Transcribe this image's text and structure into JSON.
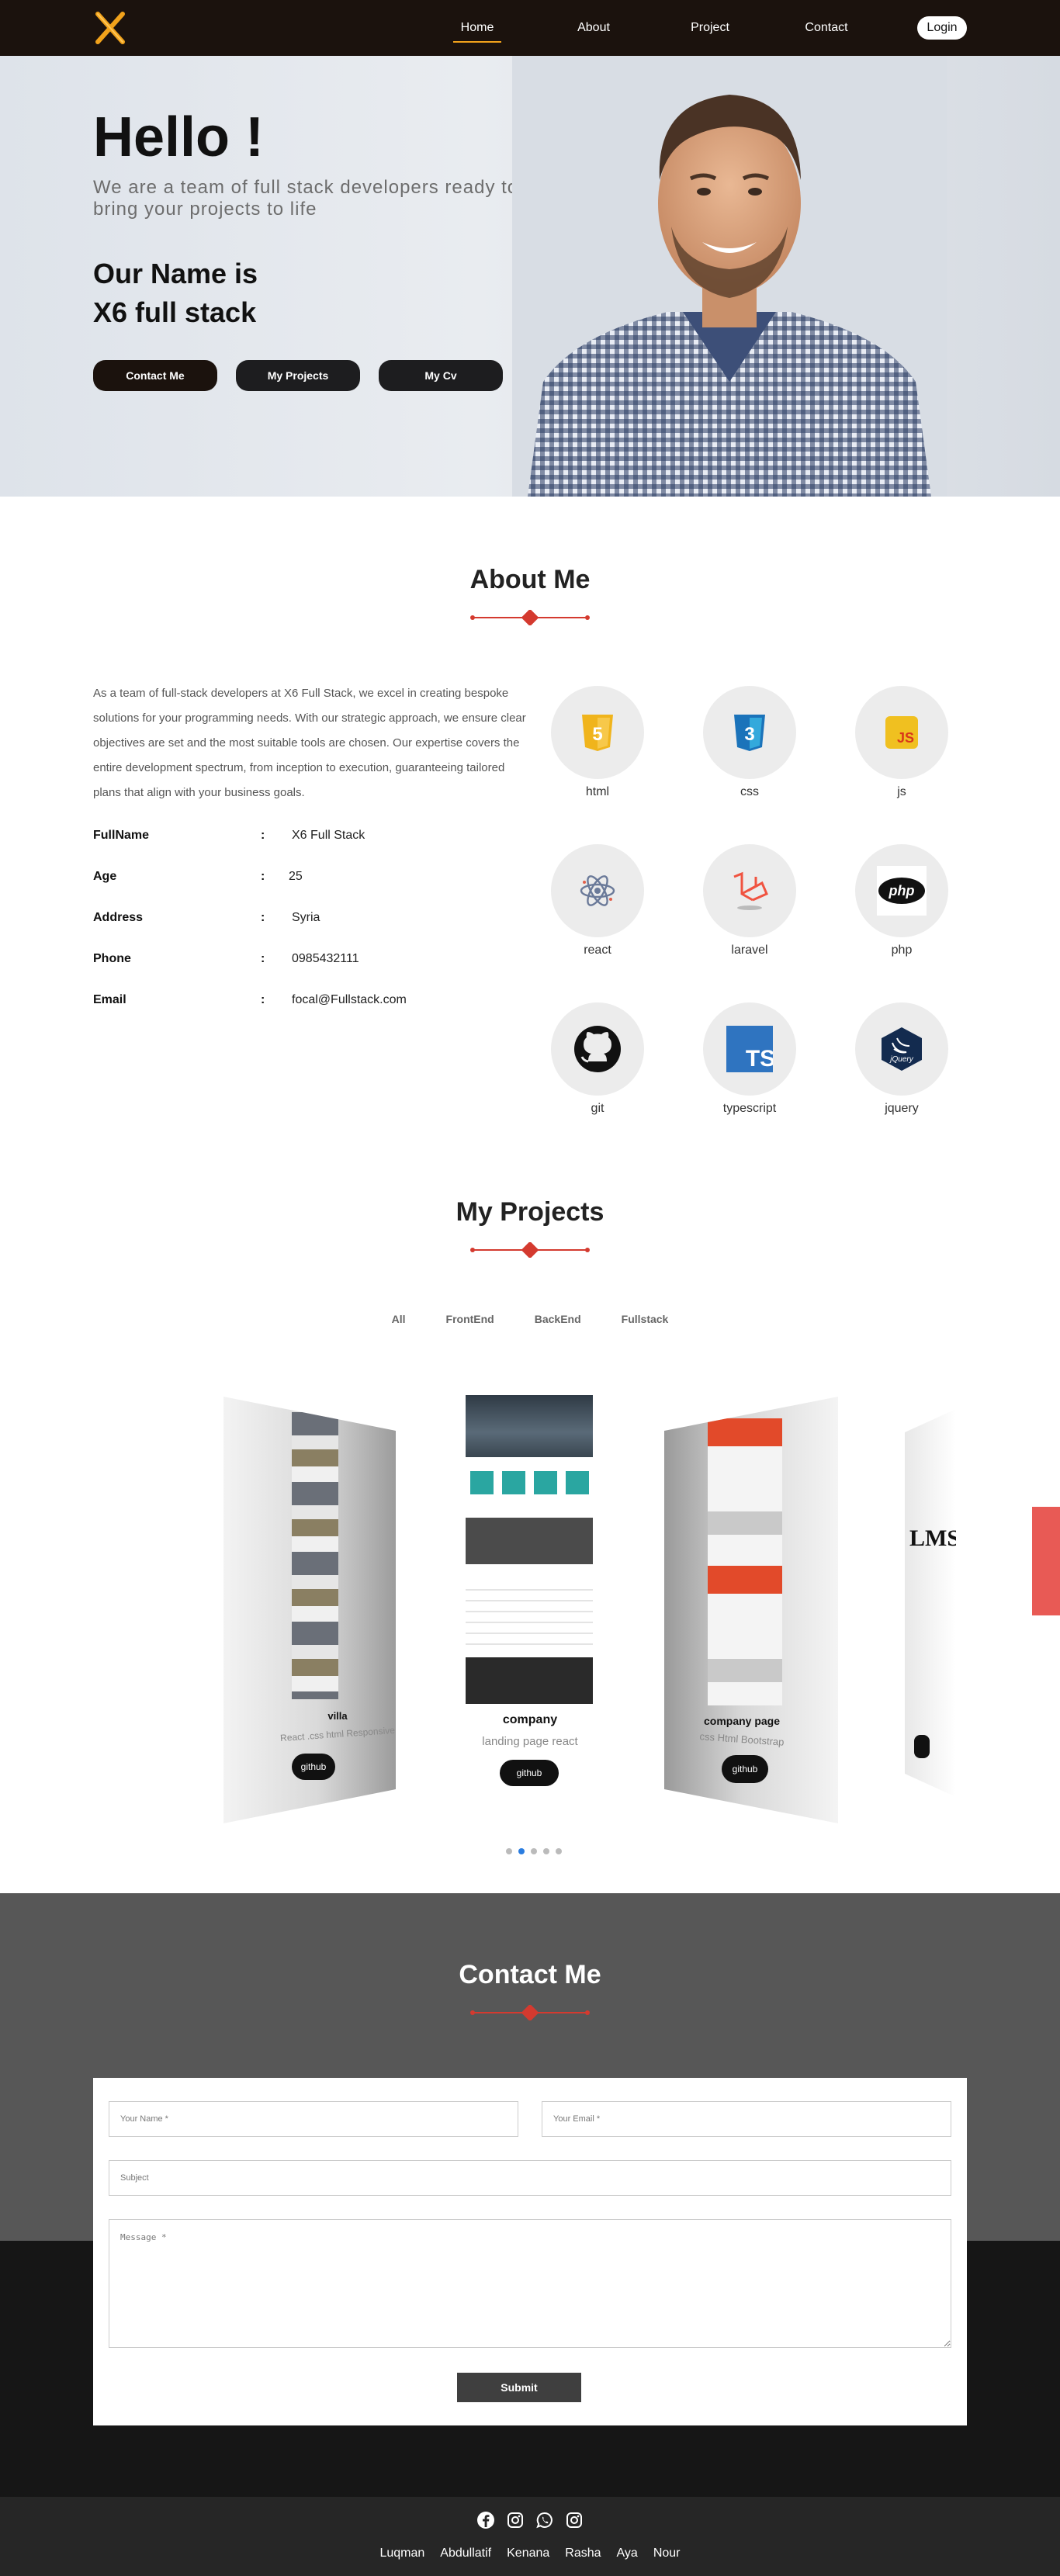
{
  "nav": {
    "links": [
      "Home",
      "About",
      "Project",
      "Contact"
    ],
    "login": "Login"
  },
  "hero": {
    "title": "Hello !",
    "subtitle": "We are a team of full stack developers ready to bring your projects to life",
    "name_line1": "Our Name is",
    "name_line2": "X6 full stack",
    "buttons": [
      "Contact Me",
      "My Projects",
      "My Cv"
    ]
  },
  "about": {
    "title": "About Me",
    "text": "As a team of full-stack developers at X6 Full Stack, we excel in creating bespoke solutions for your programming needs. With our strategic approach, we ensure clear objectives are set and the most suitable tools are chosen. Our expertise covers the entire development spectrum, from inception to execution, guaranteeing tailored plans that align with your business goals.",
    "info": [
      {
        "key": "FullName",
        "value": "X6 Full Stack"
      },
      {
        "key": "Age",
        "value": "25"
      },
      {
        "key": "Address",
        "value": "Syria"
      },
      {
        "key": "Phone",
        "value": "0985432111"
      },
      {
        "key": "Email",
        "value": "focal@Fullstack.com"
      }
    ],
    "separator": ":",
    "skills": [
      "html",
      "css",
      "js",
      "react",
      "laravel",
      "php",
      "git",
      "typescript",
      "jquery"
    ]
  },
  "projects": {
    "title": "My Projects",
    "filters": [
      "All",
      "FrontEnd",
      "BackEnd",
      "Fullstack"
    ],
    "cards": [
      {
        "title": "villa",
        "sub": "React .css html Responsive",
        "btn": "github"
      },
      {
        "title": "company",
        "sub": "landing page react",
        "btn": "github"
      },
      {
        "title": "company page",
        "sub": "css Html Bootstrap",
        "btn": "github"
      },
      {
        "title": "LMS",
        "sub": "",
        "btn": ""
      }
    ],
    "active_dot": 1,
    "dot_count": 5
  },
  "contact": {
    "title": "Contact Me",
    "name_ph": "Your Name *",
    "email_ph": "Your Email *",
    "subject_ph": "Subject",
    "message_ph": "Message *",
    "submit": "Submit"
  },
  "footer": {
    "socials": [
      "facebook-icon",
      "instagram-icon",
      "whatsapp-icon",
      "instagram-icon"
    ],
    "names": [
      "Luqman",
      "Abdullatif",
      "Kenana",
      "Rasha",
      "Aya",
      "Nour"
    ]
  },
  "colors": {
    "brand": "#1b120d",
    "accent": "#f1a21b",
    "divider": "#d43a2f"
  }
}
